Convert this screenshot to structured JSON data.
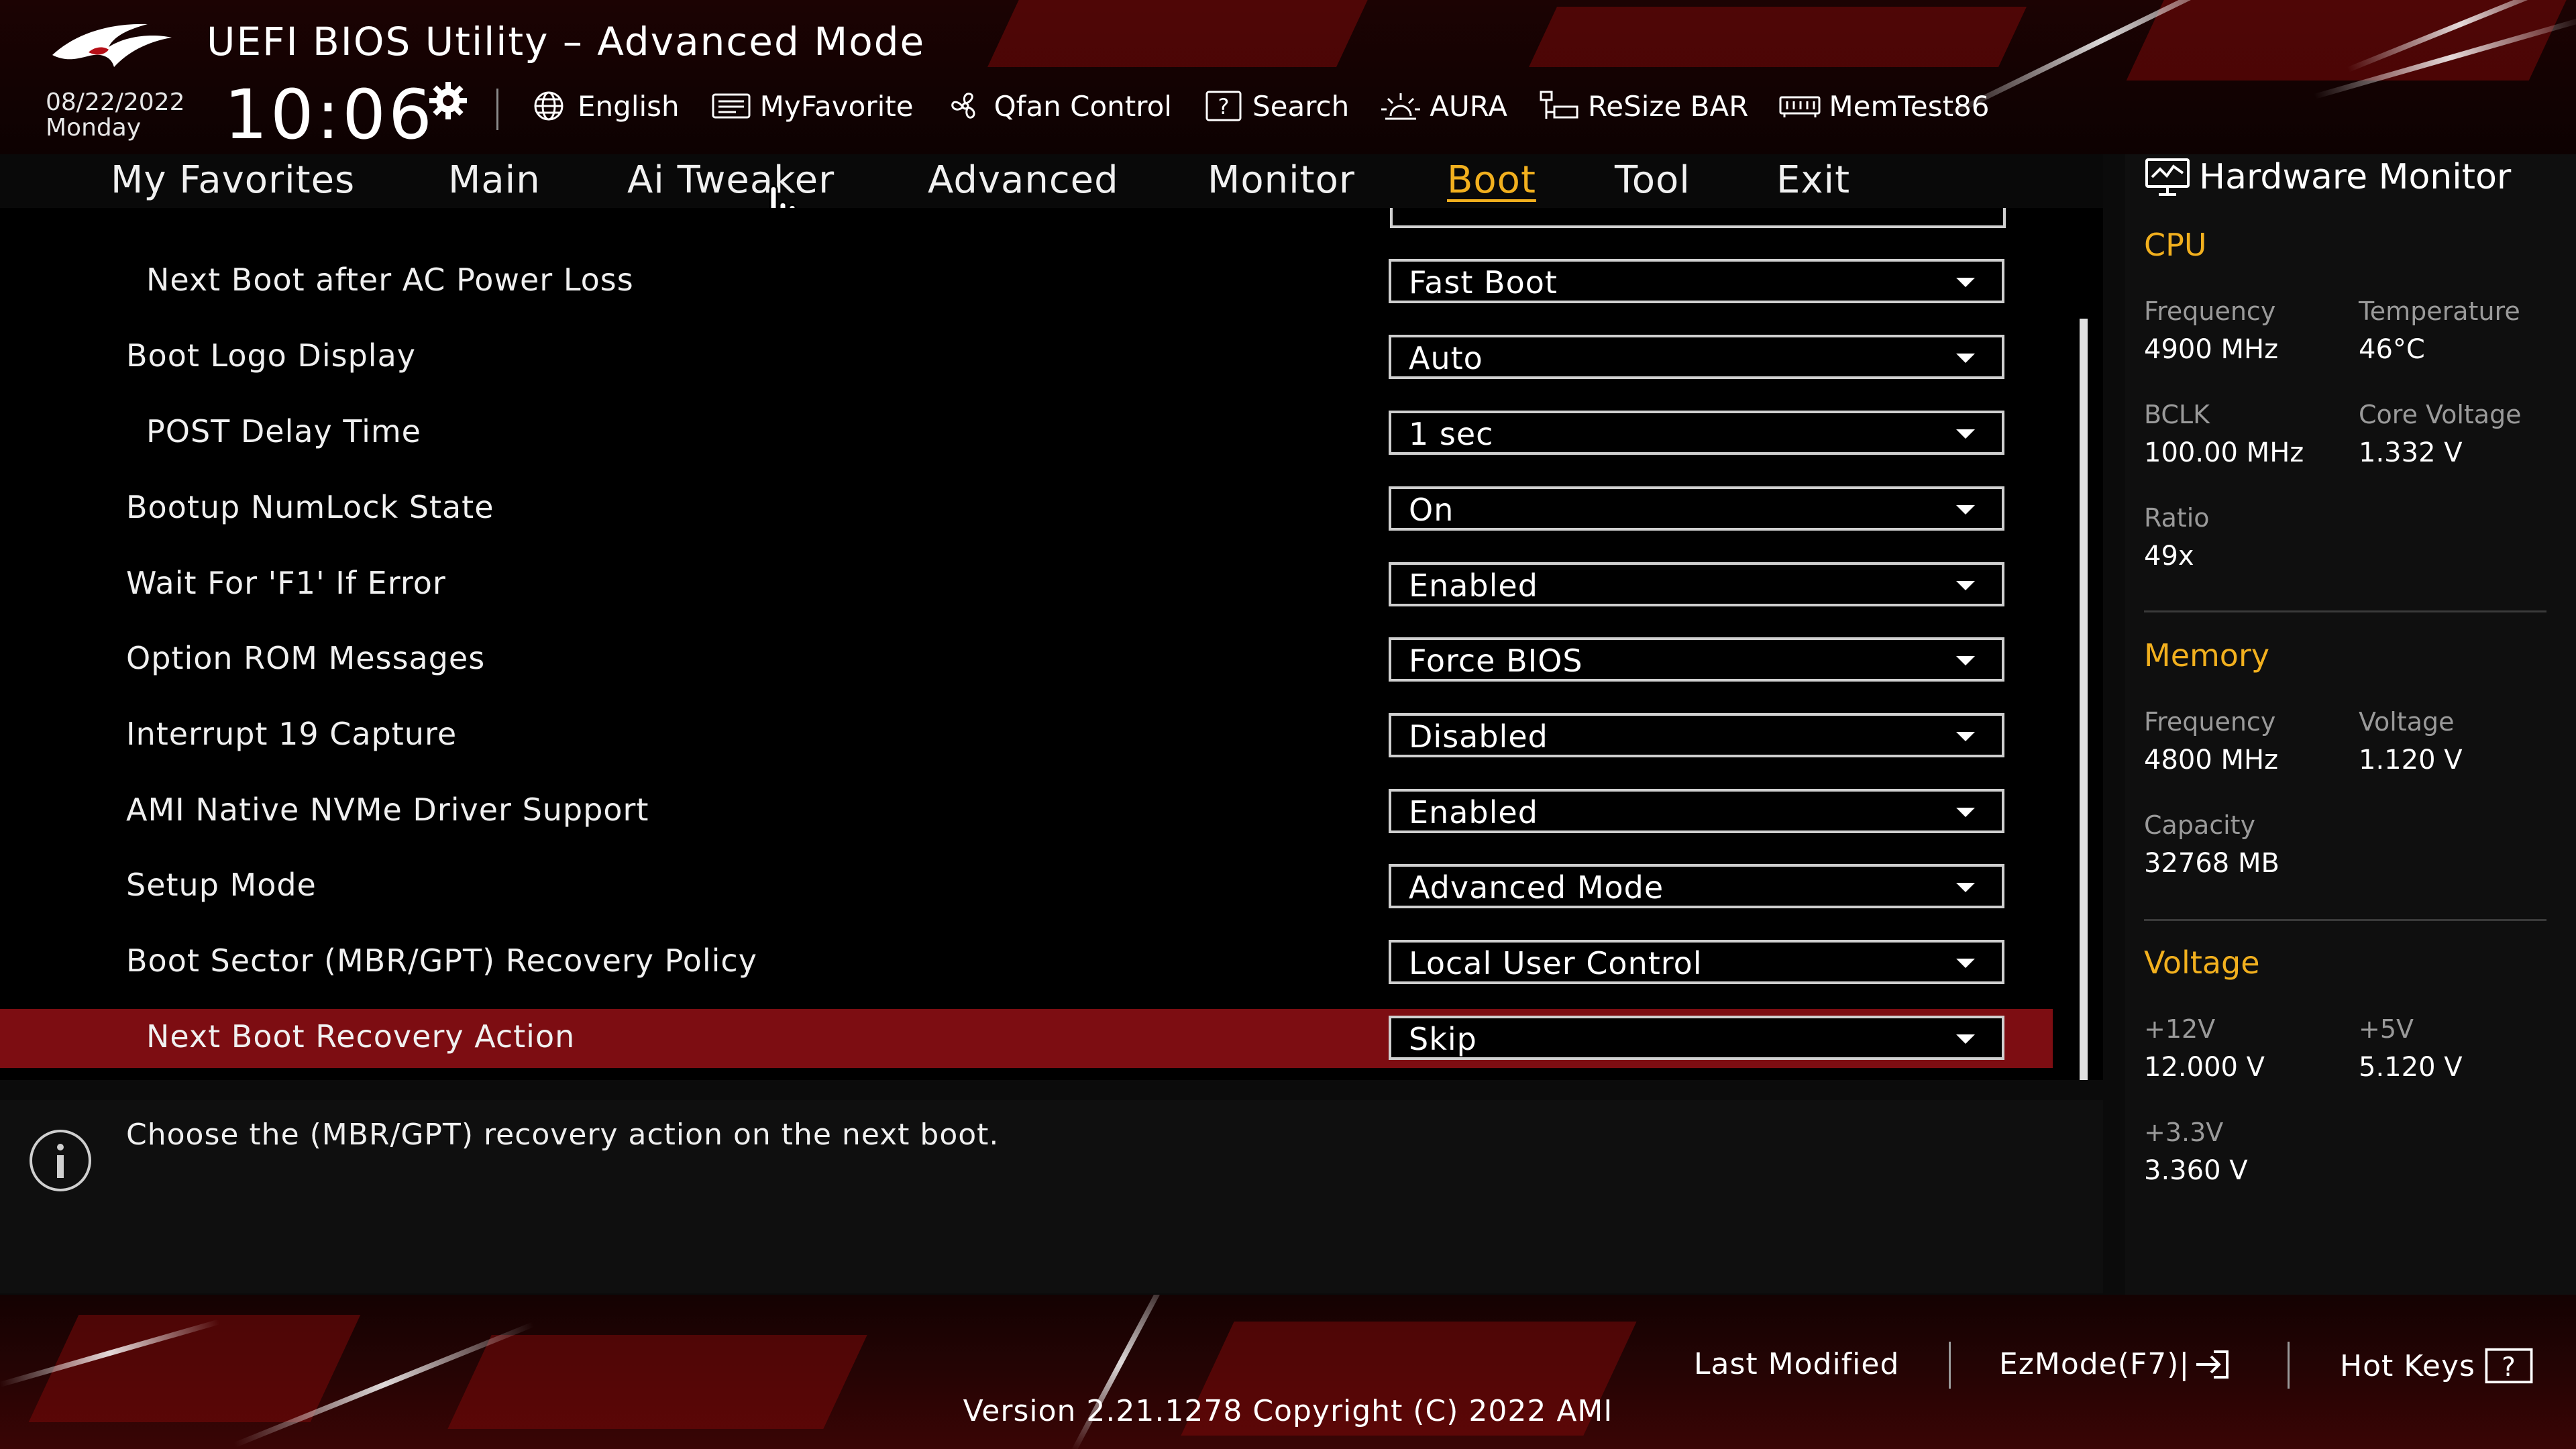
{
  "header": {
    "title": "UEFI BIOS Utility – Advanced Mode",
    "date": "08/22/2022",
    "day": "Monday",
    "time": "10:06",
    "toolbar": [
      {
        "label": "English",
        "icon": "globe-icon"
      },
      {
        "label": "MyFavorite",
        "icon": "favorite-icon"
      },
      {
        "label": "Qfan Control",
        "icon": "fan-icon"
      },
      {
        "label": "Search",
        "icon": "search-icon"
      },
      {
        "label": "AURA",
        "icon": "aura-icon"
      },
      {
        "label": "ReSize BAR",
        "icon": "resize-bar-icon"
      },
      {
        "label": "MemTest86",
        "icon": "memtest-icon"
      }
    ]
  },
  "nav": {
    "tabs": [
      "My Favorites",
      "Main",
      "Ai Tweaker",
      "Advanced",
      "Monitor",
      "Boot",
      "Tool",
      "Exit"
    ],
    "active": "Boot"
  },
  "settings": [
    {
      "label": "Next Boot after AC Power Loss",
      "value": "Fast Boot"
    },
    {
      "label": "Boot Logo Display",
      "value": "Auto"
    },
    {
      "label": "POST Delay Time",
      "value": "1 sec"
    },
    {
      "label": "Bootup NumLock State",
      "value": "On"
    },
    {
      "label": "Wait For 'F1' If Error",
      "value": "Enabled"
    },
    {
      "label": "Option ROM Messages",
      "value": "Force BIOS"
    },
    {
      "label": "Interrupt 19 Capture",
      "value": "Disabled"
    },
    {
      "label": "AMI Native NVMe Driver Support",
      "value": "Enabled"
    },
    {
      "label": "Setup Mode",
      "value": "Advanced Mode"
    },
    {
      "label": "Boot Sector (MBR/GPT) Recovery Policy",
      "value": "Local User Control"
    },
    {
      "label": "Next Boot Recovery Action",
      "value": "Skip"
    }
  ],
  "selected_setting": "Next Boot Recovery Action",
  "help_text": "Choose the (MBR/GPT) recovery action on the next boot.",
  "hardware_monitor": {
    "title": "Hardware Monitor",
    "cpu": {
      "heading": "CPU",
      "frequency_label": "Frequency",
      "frequency": "4900 MHz",
      "temperature_label": "Temperature",
      "temperature": "46°C",
      "bclk_label": "BCLK",
      "bclk": "100.00 MHz",
      "core_voltage_label": "Core Voltage",
      "core_voltage": "1.332 V",
      "ratio_label": "Ratio",
      "ratio": "49x"
    },
    "memory": {
      "heading": "Memory",
      "frequency_label": "Frequency",
      "frequency": "4800 MHz",
      "voltage_label": "Voltage",
      "voltage": "1.120 V",
      "capacity_label": "Capacity",
      "capacity": "32768 MB"
    },
    "voltage": {
      "heading": "Voltage",
      "v12_label": "+12V",
      "v12": "12.000 V",
      "v5_label": "+5V",
      "v5": "5.120 V",
      "v33_label": "+3.3V",
      "v33": "3.360 V"
    }
  },
  "footer": {
    "last_modified": "Last Modified",
    "ezmode": "EzMode(F7)|",
    "hotkeys": "Hot Keys",
    "version": "Version 2.21.1278 Copyright (C) 2022 AMI"
  },
  "colors": {
    "accent": "#f2b01e",
    "selected_row": "#7d0d12",
    "header_bg": "#1c0303",
    "panel_bg": "#000000"
  }
}
